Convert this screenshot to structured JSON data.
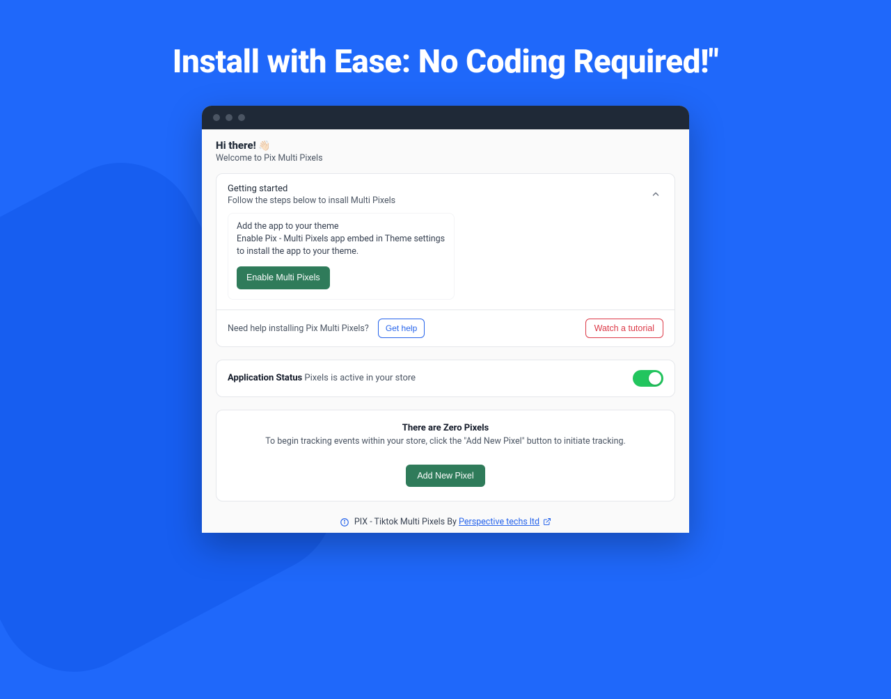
{
  "headline": "Install with Ease: No Coding Required!\"",
  "greeting": {
    "title": "Hi there!",
    "subtitle": "Welcome to Pix Multi Pixels"
  },
  "getting_started": {
    "title": "Getting started",
    "subtitle": "Follow the steps below to insall Multi Pixels",
    "step": {
      "title": "Add the app to your theme",
      "body": "Enable Pix - Multi Pixels app embed in Theme settings to install the app to your theme.",
      "enable_label": "Enable Multi Pixels"
    },
    "help_text": "Need help installing Pix Multi Pixels?",
    "get_help_label": "Get help",
    "tutorial_label": "Watch a tutorial"
  },
  "status": {
    "label": "Application Status",
    "message": "Pixels is active in your store",
    "active": true
  },
  "empty_state": {
    "title": "There are Zero Pixels",
    "body": "To begin tracking events within your store, click the \"Add New Pixel\" button to initiate tracking.",
    "cta_label": "Add New Pixel"
  },
  "footer": {
    "text": "PIX - Tiktok Multi Pixels By ",
    "link_label": "Perspective techs ltd"
  }
}
